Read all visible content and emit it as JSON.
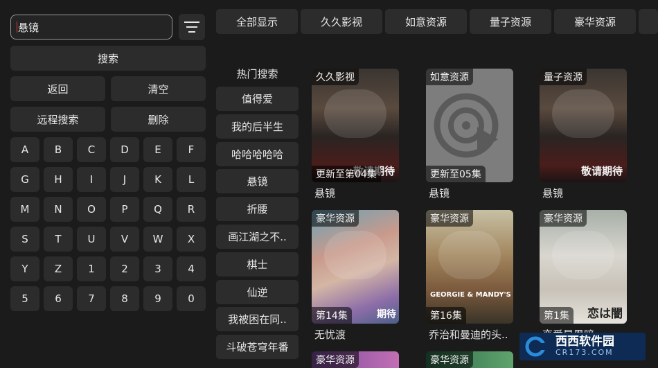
{
  "search": {
    "value": "悬镜",
    "search_label": "搜索",
    "back_label": "返回",
    "clear_label": "清空",
    "remote_label": "远程搜索",
    "delete_label": "删除"
  },
  "keyboard": [
    "A",
    "B",
    "C",
    "D",
    "E",
    "F",
    "G",
    "H",
    "I",
    "J",
    "K",
    "L",
    "M",
    "N",
    "O",
    "P",
    "Q",
    "R",
    "S",
    "T",
    "U",
    "V",
    "W",
    "X",
    "Y",
    "Z",
    "1",
    "2",
    "3",
    "4",
    "5",
    "6",
    "7",
    "8",
    "9",
    "0"
  ],
  "tabs": [
    "全部显示",
    "久久影视",
    "如意资源",
    "量子资源",
    "豪华资源"
  ],
  "hot": {
    "title": "热门搜索",
    "items": [
      "值得爱",
      "我的后半生",
      "哈哈哈哈哈",
      "悬镜",
      "折腰",
      "画江湖之不..",
      "棋士",
      "仙逆",
      "我被困在同..",
      "斗破苍穹年番"
    ]
  },
  "cards": [
    {
      "source": "久久影视",
      "status": "更新至第04集",
      "title": "悬镜",
      "style": "p-dark",
      "poster_text": "敬请期待"
    },
    {
      "source": "如意资源",
      "status": "更新至05集",
      "title": "悬镜",
      "style": "p-gray",
      "poster_text": ""
    },
    {
      "source": "量子资源",
      "status": "",
      "title": "悬镜",
      "style": "p-dark",
      "poster_text": "敬请期待"
    },
    {
      "source": "豪华资源",
      "status": "第14集",
      "title": "无忧渡",
      "style": "p-fantasy",
      "poster_text": "期待"
    },
    {
      "source": "豪华资源",
      "status": "第16集",
      "title": "乔治和曼迪的头..",
      "style": "p-georgie",
      "poster_text": "GEORGIE & MANDY'S"
    },
    {
      "source": "豪华资源",
      "status": "第1集",
      "title": "恋爱是黑暗",
      "style": "p-love",
      "poster_text": "恋は闇"
    }
  ],
  "partial_cards": [
    {
      "source": "豪华资源",
      "style": "p-strip1"
    },
    {
      "source": "豪华资源",
      "style": "p-strip2"
    }
  ],
  "watermark": {
    "brand": "西西软件园",
    "url": "CR173.COM"
  },
  "icons": {
    "filter": "filter-icon",
    "play": "disc-play-icon"
  }
}
